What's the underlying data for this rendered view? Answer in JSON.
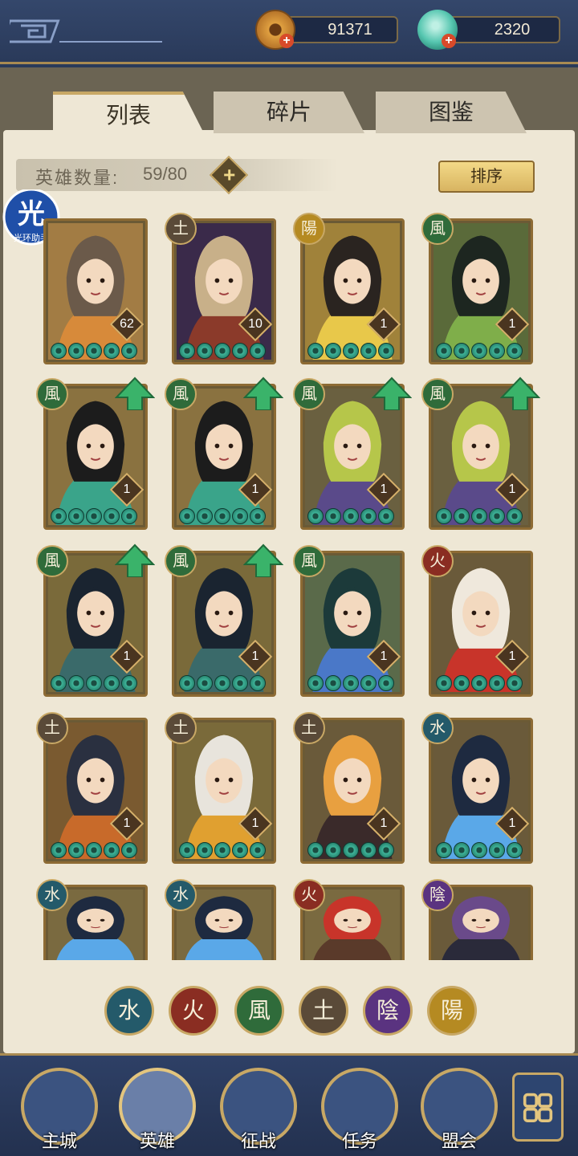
{
  "resources": {
    "copper": {
      "value": "91371",
      "icon": "copper-coin-icon"
    },
    "jade": {
      "value": "2320",
      "icon": "jade-bag-icon"
    }
  },
  "tabs": [
    {
      "label": "列表",
      "active": true
    },
    {
      "label": "碎片",
      "active": false
    },
    {
      "label": "图鉴",
      "active": false
    }
  ],
  "hero_count": {
    "label": "英雄数量:",
    "value": "59/80"
  },
  "sort_label": "排序",
  "badge": {
    "glyph": "光",
    "text": "光环助手"
  },
  "heroes": [
    {
      "element": "",
      "level": "62",
      "stars": 5,
      "upgrade": false,
      "palette": [
        "#a27c44",
        "#d78a3a",
        "#6b5a4a"
      ]
    },
    {
      "element": "土",
      "level": "10",
      "stars": 5,
      "upgrade": false,
      "palette": [
        "#3a2a4a",
        "#8b3a2a",
        "#c8b089"
      ]
    },
    {
      "element": "陽",
      "level": "1",
      "stars": 5,
      "upgrade": false,
      "palette": [
        "#a0823a",
        "#e8c84a",
        "#2a2420"
      ]
    },
    {
      "element": "風",
      "level": "1",
      "stars": 5,
      "upgrade": false,
      "palette": [
        "#5a6a3a",
        "#7fae4a",
        "#1d2620"
      ]
    },
    {
      "element": "風",
      "level": "1",
      "stars": 5,
      "upgrade": true,
      "palette": [
        "#8a7240",
        "#3aa48a",
        "#1c1c1c"
      ]
    },
    {
      "element": "風",
      "level": "1",
      "stars": 5,
      "upgrade": true,
      "palette": [
        "#8a7240",
        "#3aa48a",
        "#1c1c1c"
      ]
    },
    {
      "element": "風",
      "level": "1",
      "stars": 5,
      "upgrade": true,
      "palette": [
        "#6a6040",
        "#5a4a8a",
        "#b6c64a"
      ]
    },
    {
      "element": "風",
      "level": "1",
      "stars": 5,
      "upgrade": true,
      "palette": [
        "#6a6040",
        "#5a4a8a",
        "#b6c64a"
      ]
    },
    {
      "element": "風",
      "level": "1",
      "stars": 5,
      "upgrade": true,
      "palette": [
        "#7a6a3a",
        "#3a6a6a",
        "#1a2430"
      ]
    },
    {
      "element": "風",
      "level": "1",
      "stars": 5,
      "upgrade": true,
      "palette": [
        "#7a6a3a",
        "#3a6a6a",
        "#1a2430"
      ]
    },
    {
      "element": "風",
      "level": "1",
      "stars": 5,
      "upgrade": false,
      "palette": [
        "#5a6a4a",
        "#4a78c8",
        "#1c3a3a"
      ]
    },
    {
      "element": "火",
      "level": "1",
      "stars": 5,
      "upgrade": false,
      "palette": [
        "#6a5a3a",
        "#c8342a",
        "#efe8dc"
      ]
    },
    {
      "element": "土",
      "level": "1",
      "stars": 5,
      "upgrade": false,
      "palette": [
        "#7a5a30",
        "#c86a2a",
        "#2a3040"
      ]
    },
    {
      "element": "土",
      "level": "1",
      "stars": 5,
      "upgrade": false,
      "palette": [
        "#7a6a3a",
        "#e0a030",
        "#e8e4dc"
      ]
    },
    {
      "element": "土",
      "level": "1",
      "stars": 5,
      "upgrade": false,
      "palette": [
        "#6a5a3a",
        "#3a2a2a",
        "#e8a040"
      ]
    },
    {
      "element": "水",
      "level": "1",
      "stars": 5,
      "upgrade": false,
      "palette": [
        "#6a5a3a",
        "#5aa8e8",
        "#1e2a40"
      ]
    },
    {
      "element": "水",
      "level": "",
      "stars": 0,
      "upgrade": false,
      "palette": [
        "#7a6a40",
        "#5aa8e8",
        "#1e2a40"
      ]
    },
    {
      "element": "水",
      "level": "",
      "stars": 0,
      "upgrade": false,
      "palette": [
        "#7a6a40",
        "#5aa8e8",
        "#1e2a40"
      ]
    },
    {
      "element": "火",
      "level": "",
      "stars": 0,
      "upgrade": false,
      "palette": [
        "#7a6a40",
        "#5a3a2a",
        "#c8342a"
      ]
    },
    {
      "element": "陰",
      "level": "",
      "stars": 0,
      "upgrade": false,
      "palette": [
        "#6a5a3a",
        "#2a2a3a",
        "#6a4a8a"
      ]
    }
  ],
  "filters": [
    {
      "glyph": "水",
      "cls": "water"
    },
    {
      "glyph": "火",
      "cls": "fire"
    },
    {
      "glyph": "風",
      "cls": "wood"
    },
    {
      "glyph": "土",
      "cls": "earth"
    },
    {
      "glyph": "陰",
      "cls": "yin"
    },
    {
      "glyph": "陽",
      "cls": "yang"
    }
  ],
  "nav": [
    {
      "label": "主城",
      "icon": "city-gate-icon",
      "active": false
    },
    {
      "label": "英雄",
      "icon": "hero-portrait-icon",
      "active": true
    },
    {
      "label": "征战",
      "icon": "war-drum-icon",
      "active": false
    },
    {
      "label": "任务",
      "icon": "scroll-quest-icon",
      "active": false
    },
    {
      "label": "盟会",
      "icon": "guild-pavilion-icon",
      "active": false
    }
  ],
  "more_icon": "flower-menu-icon"
}
